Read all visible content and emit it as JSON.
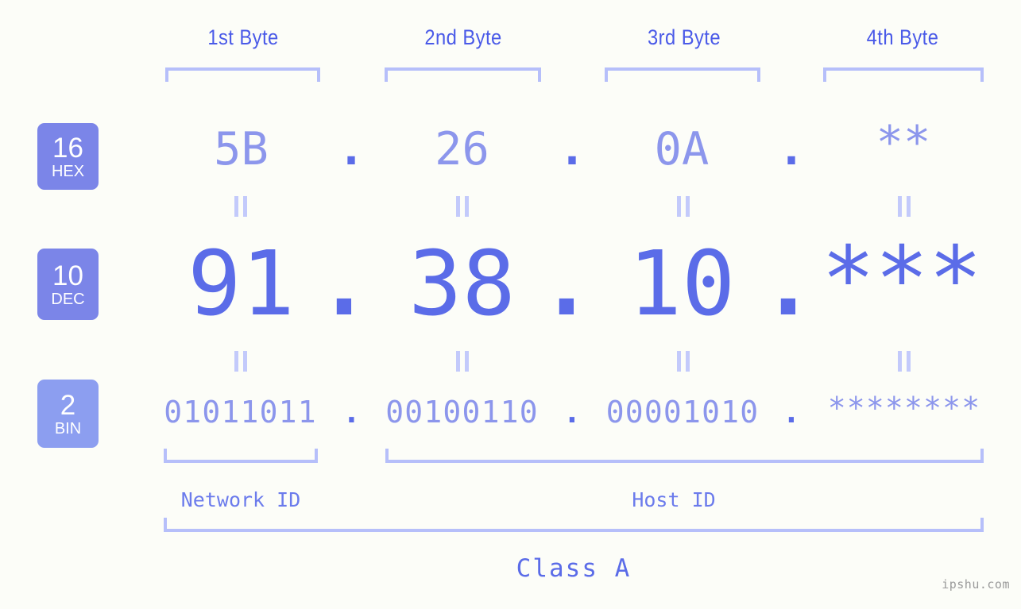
{
  "background_color": "#fcfdf8",
  "accent_colors": {
    "primary": "#5b6ce8",
    "light": "#8c96ec",
    "bracket": "#b6bffa",
    "badge_hex": "#7b85e8",
    "badge_dec": "#7b85e8",
    "badge_bin": "#8c9ef0",
    "label": "#4a5ae8",
    "watermark": "#9a9a9a"
  },
  "header": {
    "byte_labels": [
      {
        "text": "1st Byte"
      },
      {
        "text": "2nd Byte"
      },
      {
        "text": "3rd Byte"
      },
      {
        "text": "4th Byte"
      }
    ]
  },
  "rows": {
    "hex": {
      "badge_number": "16",
      "badge_name": "HEX",
      "values": [
        "5B",
        "26",
        "0A",
        "**"
      ],
      "separator": "."
    },
    "dec": {
      "badge_number": "10",
      "badge_name": "DEC",
      "values": [
        "91",
        "38",
        "10",
        "***"
      ],
      "separator": "."
    },
    "bin": {
      "badge_number": "2",
      "badge_name": "BIN",
      "values": [
        "01011011",
        "00100110",
        "00001010",
        "********"
      ],
      "separator": "."
    }
  },
  "equal_marks": {
    "symbol": "=",
    "count_per_gap": 4
  },
  "footer": {
    "network_id_label": "Network ID",
    "host_id_label": "Host ID",
    "class_label": "Class A",
    "watermark": "ipshu.com"
  }
}
